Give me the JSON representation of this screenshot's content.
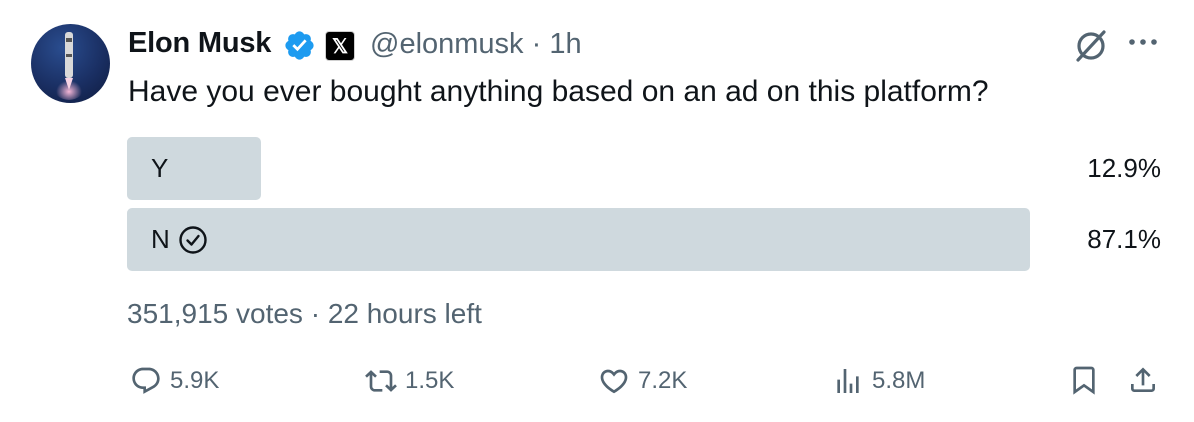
{
  "author": {
    "name": "Elon Musk",
    "handle": "@elonmusk",
    "time": "1h",
    "separator": "·",
    "affiliate_badge": "𝕏"
  },
  "tweet": {
    "text": "Have you ever bought anything based on an ad on this platform?"
  },
  "poll": {
    "options": [
      {
        "label": "Y",
        "percent": "12.9%",
        "share": 0.129,
        "selected": false
      },
      {
        "label": "N",
        "percent": "87.1%",
        "share": 0.871,
        "selected": true
      }
    ],
    "votes": "351,915 votes",
    "time_left": "22 hours left"
  },
  "actions": {
    "replies": "5.9K",
    "reposts": "1.5K",
    "likes": "7.2K",
    "views": "5.8M"
  },
  "icons": {
    "verified": "verified-badge-icon",
    "grok": "grok-icon",
    "more": "more-icon",
    "reply": "reply-icon",
    "repost": "repost-icon",
    "like": "like-icon",
    "views": "views-icon",
    "bookmark": "bookmark-icon",
    "share": "share-icon",
    "check": "check-circle-icon"
  },
  "colors": {
    "verified_blue": "#1d9bf0",
    "poll_bar": "#cfd9de",
    "secondary_text": "#536471",
    "primary_text": "#0f1419"
  }
}
